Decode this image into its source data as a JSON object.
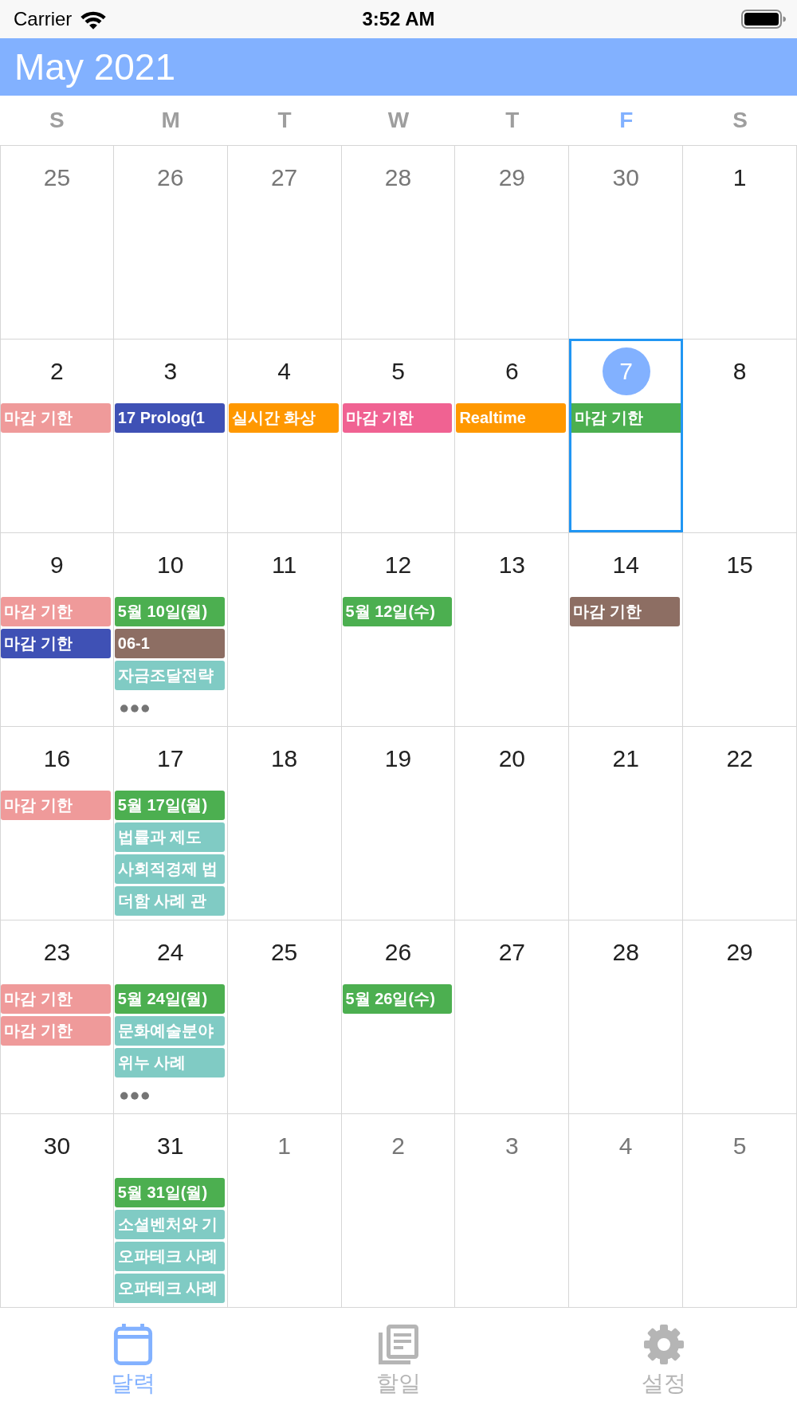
{
  "status_bar": {
    "carrier": "Carrier",
    "time": "3:52 AM"
  },
  "header": {
    "title": "May 2021"
  },
  "weekdays": [
    {
      "label": "S",
      "today": false
    },
    {
      "label": "M",
      "today": false
    },
    {
      "label": "T",
      "today": false
    },
    {
      "label": "W",
      "today": false
    },
    {
      "label": "T",
      "today": false
    },
    {
      "label": "F",
      "today": true
    },
    {
      "label": "S",
      "today": false
    }
  ],
  "weeks": [
    {
      "days": [
        {
          "date": "25",
          "in_month": false,
          "today": false,
          "selected": false,
          "more": false
        },
        {
          "date": "26",
          "in_month": false,
          "today": false,
          "selected": false,
          "more": false
        },
        {
          "date": "27",
          "in_month": false,
          "today": false,
          "selected": false,
          "more": false
        },
        {
          "date": "28",
          "in_month": false,
          "today": false,
          "selected": false,
          "more": false
        },
        {
          "date": "29",
          "in_month": false,
          "today": false,
          "selected": false,
          "more": false
        },
        {
          "date": "30",
          "in_month": false,
          "today": false,
          "selected": false,
          "more": false
        },
        {
          "date": "1",
          "in_month": true,
          "today": false,
          "selected": false,
          "more": false
        }
      ]
    },
    {
      "days": [
        {
          "date": "2",
          "in_month": true,
          "today": false,
          "selected": false,
          "more": false,
          "events": [
            {
              "title": "마감 기한",
              "color": "#ef9a9a"
            }
          ]
        },
        {
          "date": "3",
          "in_month": true,
          "today": false,
          "selected": false,
          "more": false,
          "events": [
            {
              "title": "17 Prolog(1",
              "color": "#3f51b5"
            }
          ]
        },
        {
          "date": "4",
          "in_month": true,
          "today": false,
          "selected": false,
          "more": false,
          "events": [
            {
              "title": "실시간 화상",
              "color": "#ff9800"
            }
          ]
        },
        {
          "date": "5",
          "in_month": true,
          "today": false,
          "selected": false,
          "more": false,
          "events": [
            {
              "title": "마감 기한",
              "color": "#f06292"
            }
          ]
        },
        {
          "date": "6",
          "in_month": true,
          "today": false,
          "selected": false,
          "more": false,
          "events": [
            {
              "title": "Realtime",
              "color": "#ff9800"
            }
          ]
        },
        {
          "date": "7",
          "in_month": true,
          "today": true,
          "selected": true,
          "more": false,
          "events": [
            {
              "title": "마감 기한",
              "color": "#4caf50"
            }
          ]
        },
        {
          "date": "8",
          "in_month": true,
          "today": false,
          "selected": false,
          "more": false
        }
      ]
    },
    {
      "days": [
        {
          "date": "9",
          "in_month": true,
          "today": false,
          "selected": false,
          "more": false,
          "events": [
            {
              "title": "마감 기한",
              "color": "#ef9a9a"
            },
            {
              "title": "마감 기한",
              "color": "#3f51b5"
            }
          ]
        },
        {
          "date": "10",
          "in_month": true,
          "today": false,
          "selected": false,
          "more": true,
          "events": [
            {
              "title": "5월 10일(월)",
              "color": "#4caf50"
            },
            {
              "title": "06-1",
              "color": "#8d6e63"
            },
            {
              "title": "자금조달전략",
              "color": "#80cbc4"
            }
          ]
        },
        {
          "date": "11",
          "in_month": true,
          "today": false,
          "selected": false,
          "more": false
        },
        {
          "date": "12",
          "in_month": true,
          "today": false,
          "selected": false,
          "more": false,
          "events": [
            {
              "title": "5월 12일(수)",
              "color": "#4caf50"
            }
          ]
        },
        {
          "date": "13",
          "in_month": true,
          "today": false,
          "selected": false,
          "more": false
        },
        {
          "date": "14",
          "in_month": true,
          "today": false,
          "selected": false,
          "more": false,
          "events": [
            {
              "title": "마감 기한",
              "color": "#8d6e63"
            }
          ]
        },
        {
          "date": "15",
          "in_month": true,
          "today": false,
          "selected": false,
          "more": false
        }
      ]
    },
    {
      "days": [
        {
          "date": "16",
          "in_month": true,
          "today": false,
          "selected": false,
          "more": false,
          "events": [
            {
              "title": "마감 기한",
              "color": "#ef9a9a"
            }
          ]
        },
        {
          "date": "17",
          "in_month": true,
          "today": false,
          "selected": false,
          "more": false,
          "events": [
            {
              "title": "5월 17일(월)",
              "color": "#4caf50"
            },
            {
              "title": "법률과 제도",
              "color": "#80cbc4"
            },
            {
              "title": "사회적경제 법",
              "color": "#80cbc4"
            },
            {
              "title": "더함 사례 관",
              "color": "#80cbc4"
            }
          ]
        },
        {
          "date": "18",
          "in_month": true,
          "today": false,
          "selected": false,
          "more": false
        },
        {
          "date": "19",
          "in_month": true,
          "today": false,
          "selected": false,
          "more": false
        },
        {
          "date": "20",
          "in_month": true,
          "today": false,
          "selected": false,
          "more": false
        },
        {
          "date": "21",
          "in_month": true,
          "today": false,
          "selected": false,
          "more": false
        },
        {
          "date": "22",
          "in_month": true,
          "today": false,
          "selected": false,
          "more": false
        }
      ]
    },
    {
      "days": [
        {
          "date": "23",
          "in_month": true,
          "today": false,
          "selected": false,
          "more": false,
          "events": [
            {
              "title": "마감 기한",
              "color": "#ef9a9a"
            },
            {
              "title": "마감 기한",
              "color": "#ef9a9a"
            }
          ]
        },
        {
          "date": "24",
          "in_month": true,
          "today": false,
          "selected": false,
          "more": true,
          "events": [
            {
              "title": "5월 24일(월)",
              "color": "#4caf50"
            },
            {
              "title": "문화예술분야",
              "color": "#80cbc4"
            },
            {
              "title": "위누 사례",
              "color": "#80cbc4"
            }
          ]
        },
        {
          "date": "25",
          "in_month": true,
          "today": false,
          "selected": false,
          "more": false
        },
        {
          "date": "26",
          "in_month": true,
          "today": false,
          "selected": false,
          "more": false,
          "events": [
            {
              "title": "5월 26일(수)",
              "color": "#4caf50"
            }
          ]
        },
        {
          "date": "27",
          "in_month": true,
          "today": false,
          "selected": false,
          "more": false
        },
        {
          "date": "28",
          "in_month": true,
          "today": false,
          "selected": false,
          "more": false
        },
        {
          "date": "29",
          "in_month": true,
          "today": false,
          "selected": false,
          "more": false
        }
      ]
    },
    {
      "days": [
        {
          "date": "30",
          "in_month": true,
          "today": false,
          "selected": false,
          "more": false
        },
        {
          "date": "31",
          "in_month": true,
          "today": false,
          "selected": false,
          "more": false,
          "events": [
            {
              "title": "5월 31일(월)",
              "color": "#4caf50"
            },
            {
              "title": "소셜벤처와 기",
              "color": "#80cbc4"
            },
            {
              "title": "오파테크 사례",
              "color": "#80cbc4"
            },
            {
              "title": "오파테크 사례",
              "color": "#80cbc4"
            }
          ]
        },
        {
          "date": "1",
          "in_month": false,
          "today": false,
          "selected": false,
          "more": false
        },
        {
          "date": "2",
          "in_month": false,
          "today": false,
          "selected": false,
          "more": false
        },
        {
          "date": "3",
          "in_month": false,
          "today": false,
          "selected": false,
          "more": false
        },
        {
          "date": "4",
          "in_month": false,
          "today": false,
          "selected": false,
          "more": false
        },
        {
          "date": "5",
          "in_month": false,
          "today": false,
          "selected": false,
          "more": false
        }
      ]
    }
  ],
  "tab_bar": [
    {
      "label": "달력",
      "selected": true
    },
    {
      "label": "할일",
      "selected": false
    },
    {
      "label": "설정",
      "selected": false
    }
  ]
}
